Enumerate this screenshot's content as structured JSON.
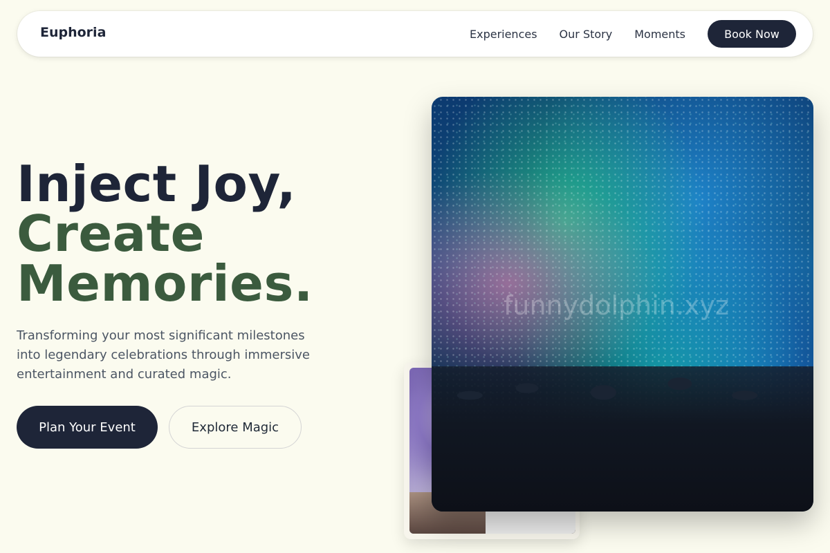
{
  "nav": {
    "brand": "Euphoria",
    "links": [
      "Experiences",
      "Our Story",
      "Moments"
    ],
    "cta": "Book Now"
  },
  "hero": {
    "headline": [
      "Inject Joy,",
      "Create",
      "Memories."
    ],
    "subtitle": "Transforming your most significant milestones into legendary celebrations through immersive entertainment and curated magic.",
    "primary_button": "Plan Your Event",
    "secondary_button": "Explore Magic"
  },
  "images": {
    "hero_alt": "concert crowd with colorful stage lights",
    "small_alt": "dj performing",
    "watermark": "funnydolphin.xyz"
  },
  "colors": {
    "background": "#fbfbef",
    "dark": "#1e2538",
    "accent_green": "#3b5b3e"
  }
}
